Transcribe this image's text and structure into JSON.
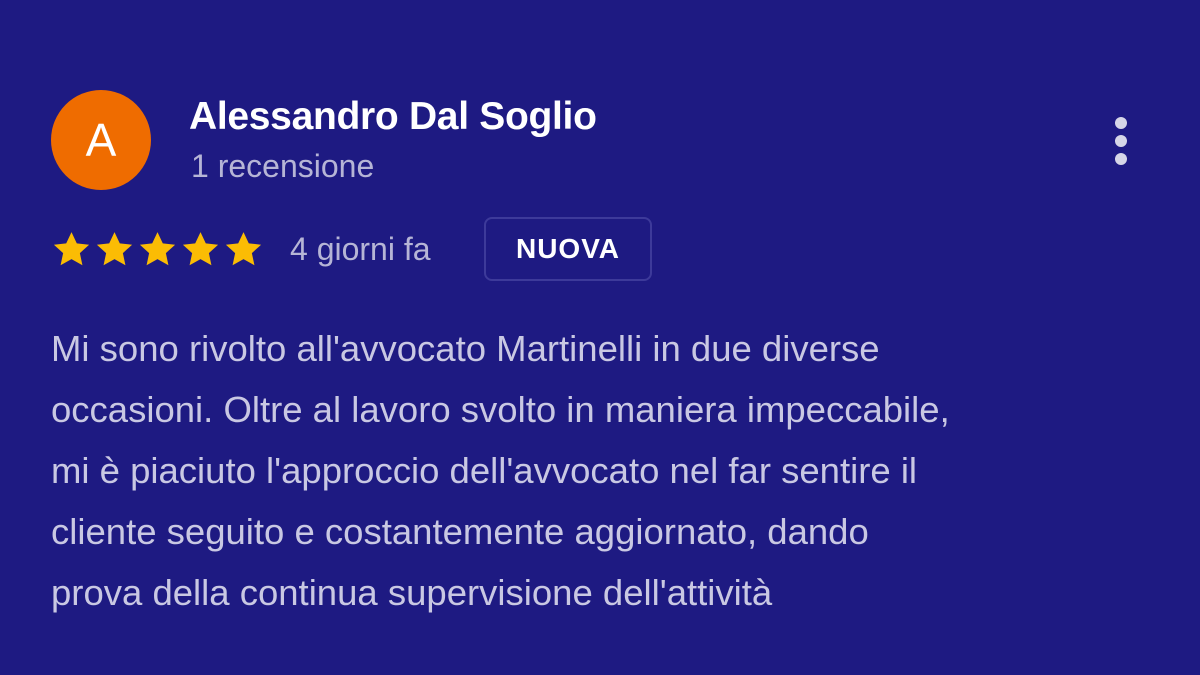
{
  "review": {
    "avatar_initial": "A",
    "avatar_color": "#ef6c00",
    "reviewer_name": "Alessandro Dal Soglio",
    "review_count": "1 recensione",
    "rating": 5,
    "rating_max": 5,
    "star_color": "#fbbc04",
    "date": "4 giorni fa",
    "badge": "NUOVA",
    "more_icon": "more-vert-icon",
    "text_lines": [
      "Mi sono rivolto all'avvocato Martinelli in due diverse",
      "occasioni. Oltre al lavoro svolto in maniera impeccabile,",
      "mi è piaciuto l'approccio dell'avvocato nel far sentire il",
      "cliente seguito e costantemente aggiornato, dando",
      "prova della continua supervisione dell'attività"
    ]
  },
  "theme": {
    "background": "#1e1a82",
    "name_color": "#ffffff",
    "muted_color": "#b6b5d6",
    "body_color": "#c9c8e3"
  }
}
